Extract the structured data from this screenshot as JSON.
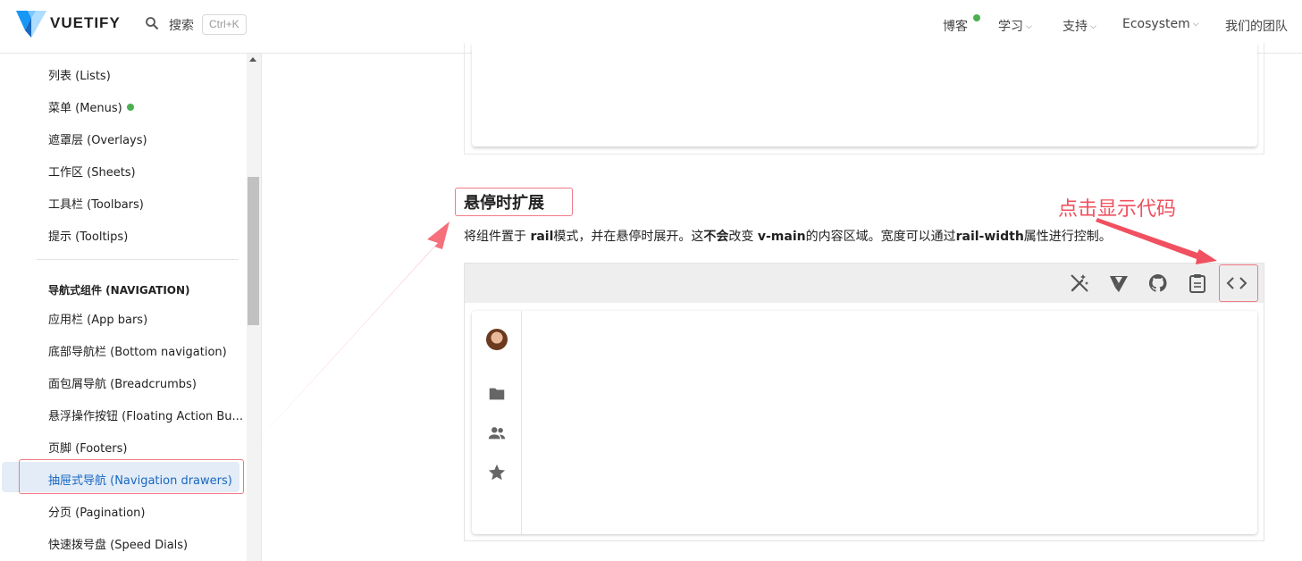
{
  "header": {
    "brand": "VUETIFY",
    "search_label": "搜索",
    "search_shortcut": "Ctrl+K",
    "nav": [
      {
        "label": "博客",
        "has_dot": true
      },
      {
        "label": "学习",
        "has_menu": true
      },
      {
        "label": "支持",
        "has_menu": true
      },
      {
        "label": "Ecosystem",
        "has_menu": true
      },
      {
        "label": "我们的团队"
      }
    ]
  },
  "sidebar": {
    "items_top": [
      {
        "label": "列表 (Lists)"
      },
      {
        "label": "菜单 (Menus)",
        "badge": "green-dot"
      },
      {
        "label": "遮罩层 (Overlays)"
      },
      {
        "label": "工作区 (Sheets)"
      },
      {
        "label": "工具栏 (Toolbars)"
      },
      {
        "label": "提示 (Tooltips)"
      }
    ],
    "section_header": "导航式组件 (NAVIGATION)",
    "items_nav": [
      {
        "label": "应用栏 (App bars)"
      },
      {
        "label": "底部导航栏 (Bottom navigation)"
      },
      {
        "label": "面包屑导航 (Breadcrumbs)"
      },
      {
        "label": "悬浮操作按钮 (Floating Action Bu..."
      },
      {
        "label": "页脚 (Footers)"
      },
      {
        "label": "抽屉式导航 (Navigation drawers)",
        "active": true
      },
      {
        "label": "分页 (Pagination)"
      },
      {
        "label": "快速拨号盘 (Speed Dials)"
      }
    ]
  },
  "main": {
    "section_title": "悬停时扩展",
    "description": {
      "p1": "将组件置于 ",
      "b1": "rail",
      "p2": "模式，并在悬停时展开。这",
      "b2": "不会",
      "p3": "改变 ",
      "b3": "v-main",
      "p4": "的内容区域。宽度可以通过",
      "b4": "rail-width",
      "p5": "属性进行控制。"
    },
    "annotation": "点击显示代码",
    "toolbar_icons": [
      "magic-wand-off-icon",
      "vuetify-bin-icon",
      "github-icon",
      "clipboard-icon",
      "code-icon"
    ],
    "rail_icons": [
      "avatar",
      "folder-icon",
      "account-multiple-icon",
      "star-icon"
    ]
  },
  "colors": {
    "accent": "#1867c0",
    "annotation": "#f0505f",
    "highlight_box": "#f07a86",
    "status_dot": "#4caf50"
  }
}
